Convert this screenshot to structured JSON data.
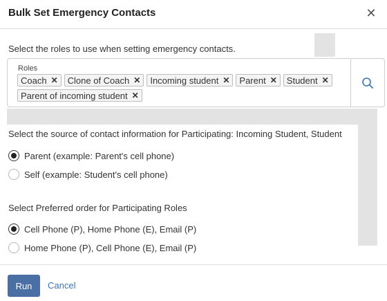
{
  "dialog": {
    "title": "Bulk Set Emergency Contacts",
    "close_icon": "close-icon"
  },
  "roles_section": {
    "prompt": "Select the roles to use when setting emergency contacts.",
    "field_label": "Roles",
    "chips": [
      "Coach",
      "Clone of Coach",
      "Incoming student",
      "Parent",
      "Student",
      "Parent of incoming student"
    ],
    "remove_symbol": "✕",
    "search_icon": "search-icon"
  },
  "source_section": {
    "prompt": "Select the source of contact information for Participating: Incoming Student, Student",
    "options": [
      {
        "label": "Parent (example: Parent's cell phone)",
        "checked": true
      },
      {
        "label": "Self (example: Student's cell phone)",
        "checked": false
      }
    ]
  },
  "order_section": {
    "prompt": "Select Preferred order for Participating Roles",
    "options": [
      {
        "label": "Cell Phone (P), Home Phone (E), Email (P)",
        "checked": true
      },
      {
        "label": "Home Phone (P), Cell Phone (E), Email (P)",
        "checked": false
      }
    ]
  },
  "footer": {
    "run_label": "Run",
    "cancel_label": "Cancel"
  },
  "colors": {
    "primary": "#4a6fa5",
    "link": "#3b74b7",
    "search_icon": "#3b74b7"
  }
}
